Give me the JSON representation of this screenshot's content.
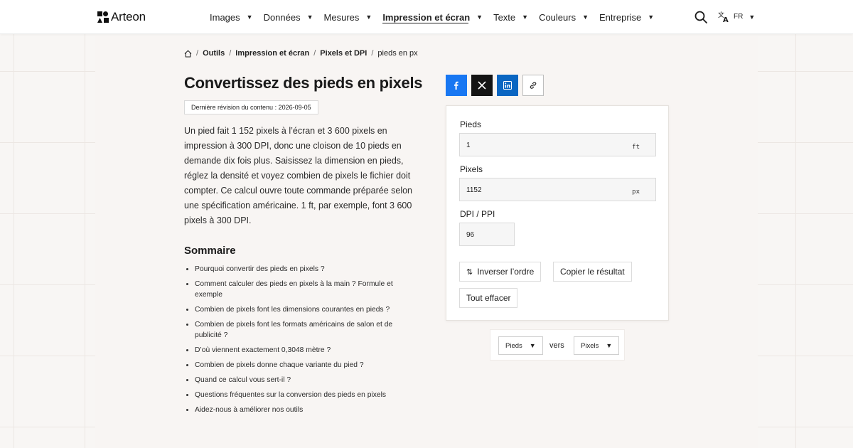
{
  "header": {
    "brand": "Arteon",
    "nav": [
      {
        "label": "Images",
        "active": false
      },
      {
        "label": "Données",
        "active": false
      },
      {
        "label": "Mesures",
        "active": false
      },
      {
        "label": "Impression et écran",
        "active": true
      },
      {
        "label": "Texte",
        "active": false
      },
      {
        "label": "Couleurs",
        "active": false
      },
      {
        "label": "Entreprise",
        "active": false
      }
    ],
    "caret": "▼",
    "lang_code": "FR"
  },
  "breadcrumb": {
    "items": [
      "Outils",
      "Impression et écran",
      "Pixels et DPI"
    ],
    "current": "pieds en px",
    "separator": "/"
  },
  "article": {
    "title": "Convertissez des pieds en pixels",
    "revision": "Dernière révision du contenu : 2026-09-05",
    "intro": "Un pied fait 1 152 pixels à l’écran et 3 600 pixels en impression à 300 DPI, donc une cloison de 10 pieds en demande dix fois plus. Saisissez la dimension en pieds, réglez la densité et voyez combien de pixels le fichier doit compter. Ce calcul ouvre toute commande préparée selon une spécification américaine. 1 ft, par exemple, font 3 600 pixels à 300 DPI.",
    "summary_title": "Sommaire",
    "toc": [
      "Pourquoi convertir des pieds en pixels ?",
      "Comment calculer des pieds en pixels à la main ? Formule et exemple",
      "Combien de pixels font les dimensions courantes en pieds ?",
      "Combien de pixels font les formats américains de salon et de publicité ?",
      "D’où viennent exactement 0,3048 mètre ?",
      "Combien de pixels donne chaque variante du pied ?",
      "Quand ce calcul vous sert-il ?",
      "Questions fréquentes sur la conversion des pieds en pixels",
      "Aidez-nous à améliorer nos outils"
    ]
  },
  "share": {
    "icons": [
      "facebook-icon",
      "x-icon",
      "linkedin-icon",
      "link-icon"
    ],
    "colors": {
      "facebook": "#1877f2",
      "x": "#141414",
      "linkedin": "#0a66c2"
    }
  },
  "converter": {
    "feet_label": "Pieds",
    "feet_value": "1",
    "feet_unit": "ft",
    "pixels_label": "Pixels",
    "pixels_value": "1152",
    "pixels_unit": "px",
    "dpi_label": "DPI / PPI",
    "dpi_value": "96",
    "swap_label": "Inverser l’ordre",
    "copy_label": "Copier le résultat",
    "clear_label": "Tout effacer"
  },
  "unit_selector": {
    "from": "Pieds",
    "connector": "vers",
    "to": "Pixels"
  }
}
